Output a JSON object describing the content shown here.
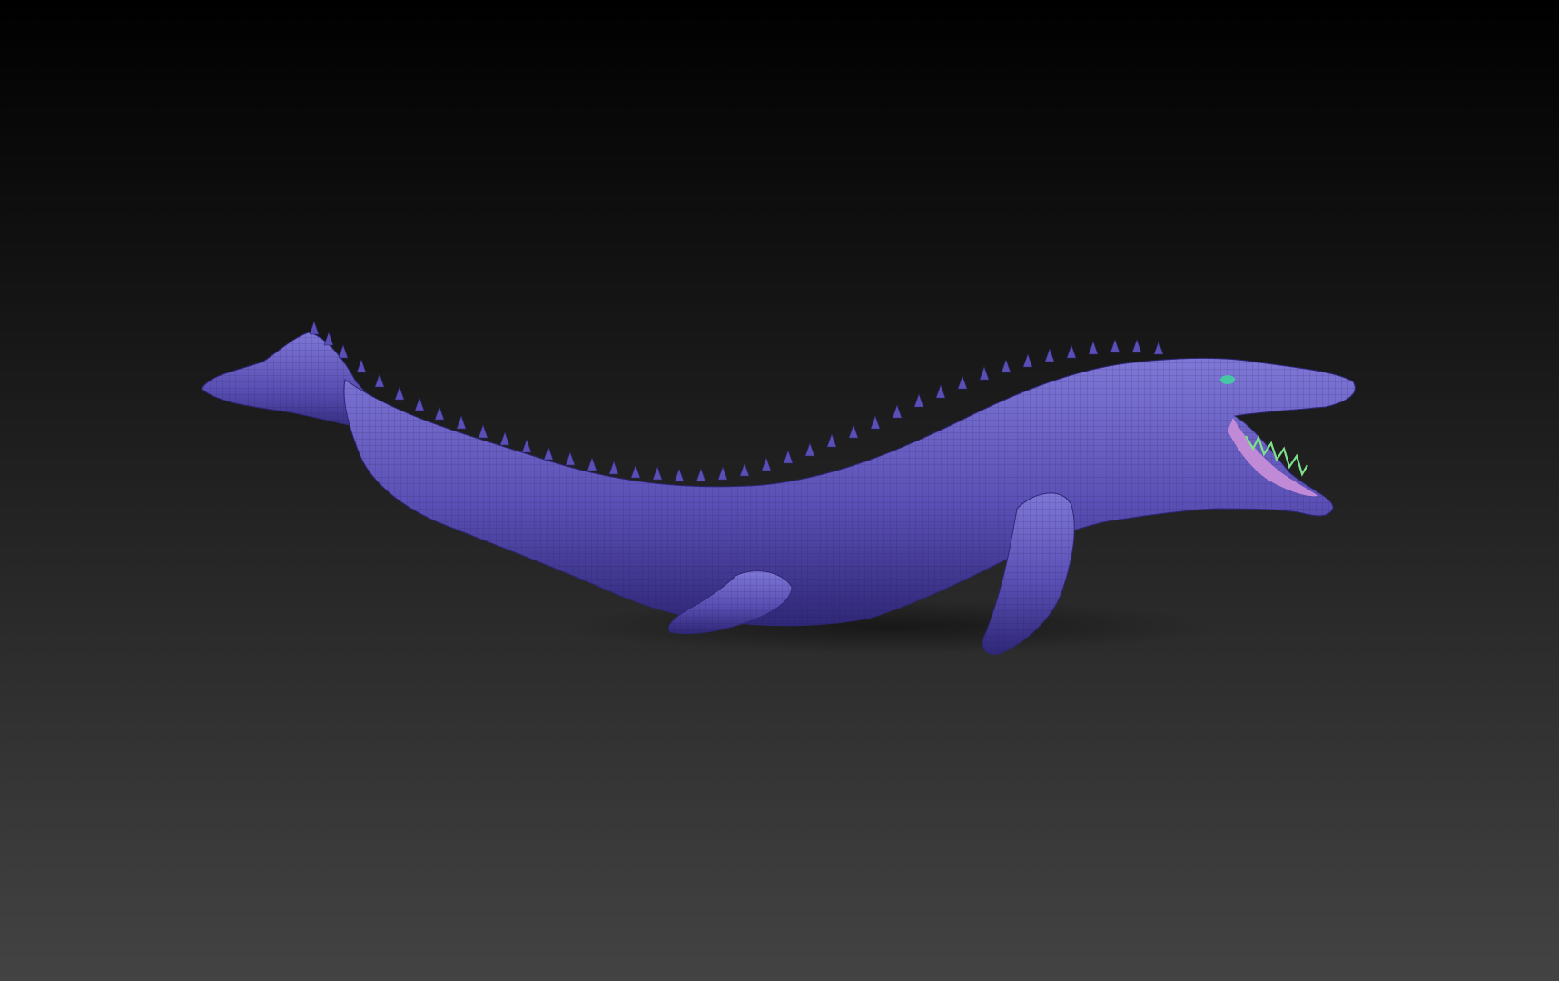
{
  "viewport": {
    "background_top_color": "#000000",
    "background_bottom_color": "#434343",
    "model": {
      "kind": "mosasaur-sculpt-mesh",
      "material_color": "#5a4fb4",
      "material_highlight": "#7f78d6",
      "material_shadow": "#2f2777",
      "mouth_color": "#c08ad6",
      "teeth_color": "#7fe08a",
      "eye_color": "#46c7a4"
    }
  }
}
